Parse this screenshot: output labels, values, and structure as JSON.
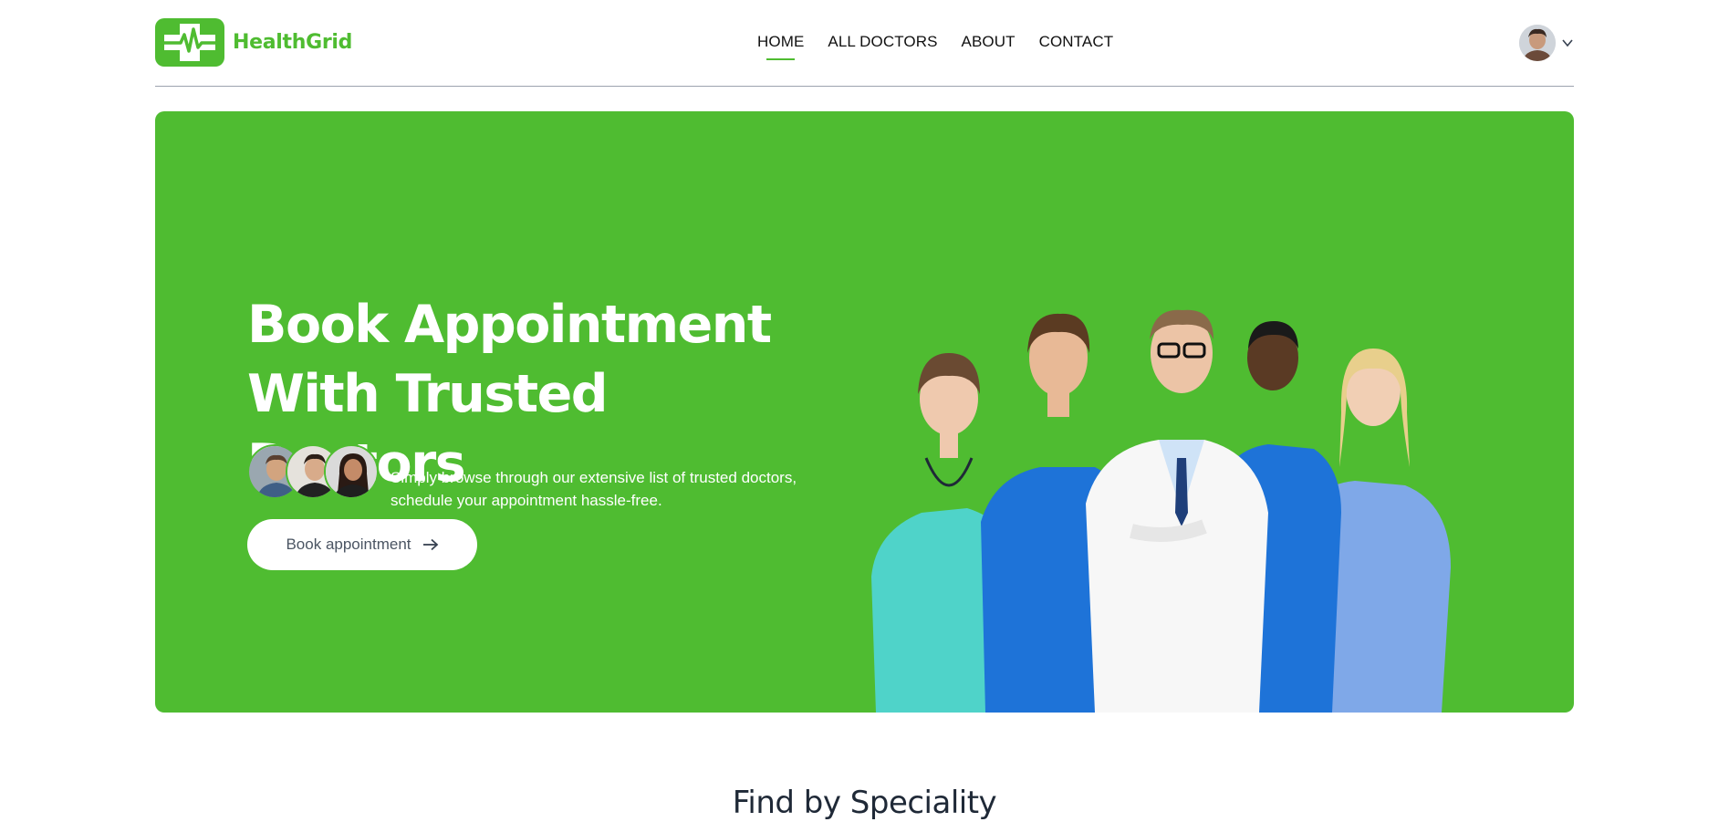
{
  "brand": {
    "name": "HealthGrid",
    "logo_icon": "medical-cross-pulse-icon",
    "color": "#4fbc31"
  },
  "nav": {
    "items": [
      {
        "label": "HOME",
        "active": true
      },
      {
        "label": "ALL DOCTORS",
        "active": false
      },
      {
        "label": "ABOUT",
        "active": false
      },
      {
        "label": "CONTACT",
        "active": false
      }
    ]
  },
  "profile": {
    "avatar_icon": "user-avatar",
    "dropdown_icon": "chevron-down-icon"
  },
  "hero": {
    "background": "#4fbc31",
    "title_line1": "Book Appointment",
    "title_line2": "With Trusted Doctors",
    "description_line1": "Simply browse through our extensive list of trusted doctors,",
    "description_line2": "schedule your appointment hassle-free.",
    "button_label": "Book appointment",
    "button_icon": "arrow-right-icon",
    "image": "group-of-doctors-photo"
  },
  "section": {
    "title": "Find by Speciality"
  }
}
